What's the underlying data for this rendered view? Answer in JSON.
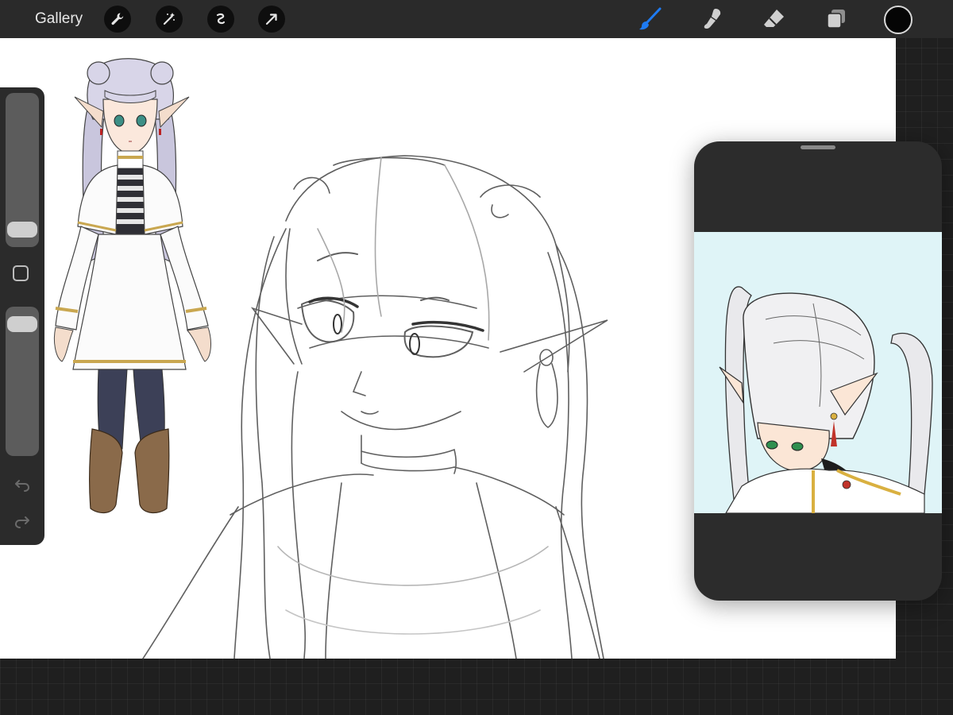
{
  "toolbar": {
    "gallery_label": "Gallery",
    "left_tools": [
      "wrench-icon",
      "magic-wand-icon",
      "selection-icon",
      "transform-arrow-icon"
    ],
    "right_tools": [
      "brush-icon",
      "smudge-icon",
      "eraser-icon",
      "layers-icon"
    ],
    "active_tool": "brush-icon",
    "colors": {
      "active_tool": "#1e7bf2",
      "inactive_tool": "#cfcfcf",
      "current_color": "#050505"
    }
  },
  "sidebar": {
    "brush_size_level": 0.05,
    "opacity_level": 0.95
  },
  "reference_window": {
    "background_color": "#dff4f7"
  }
}
